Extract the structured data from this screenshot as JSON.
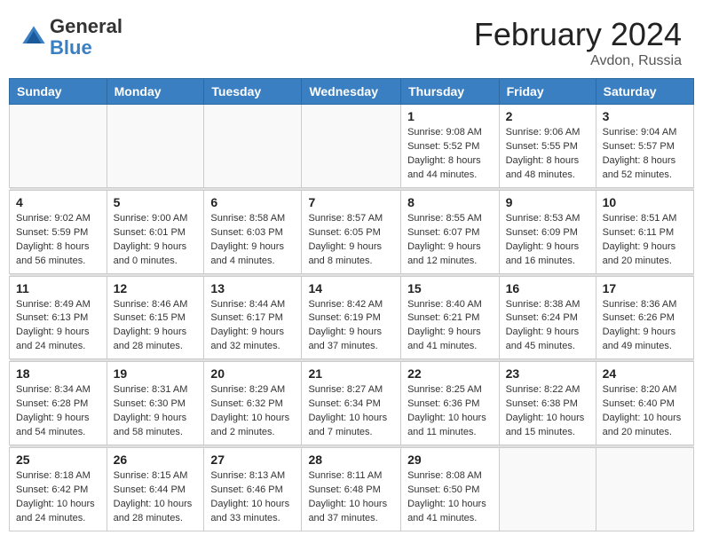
{
  "header": {
    "logo_general": "General",
    "logo_blue": "Blue",
    "month_year": "February 2024",
    "location": "Avdon, Russia"
  },
  "days_of_week": [
    "Sunday",
    "Monday",
    "Tuesday",
    "Wednesday",
    "Thursday",
    "Friday",
    "Saturday"
  ],
  "weeks": [
    [
      {
        "day": "",
        "info": "",
        "empty": true
      },
      {
        "day": "",
        "info": "",
        "empty": true
      },
      {
        "day": "",
        "info": "",
        "empty": true
      },
      {
        "day": "",
        "info": "",
        "empty": true
      },
      {
        "day": "1",
        "info": "Sunrise: 9:08 AM\nSunset: 5:52 PM\nDaylight: 8 hours\nand 44 minutes.",
        "empty": false
      },
      {
        "day": "2",
        "info": "Sunrise: 9:06 AM\nSunset: 5:55 PM\nDaylight: 8 hours\nand 48 minutes.",
        "empty": false
      },
      {
        "day": "3",
        "info": "Sunrise: 9:04 AM\nSunset: 5:57 PM\nDaylight: 8 hours\nand 52 minutes.",
        "empty": false
      }
    ],
    [
      {
        "day": "4",
        "info": "Sunrise: 9:02 AM\nSunset: 5:59 PM\nDaylight: 8 hours\nand 56 minutes.",
        "empty": false
      },
      {
        "day": "5",
        "info": "Sunrise: 9:00 AM\nSunset: 6:01 PM\nDaylight: 9 hours\nand 0 minutes.",
        "empty": false
      },
      {
        "day": "6",
        "info": "Sunrise: 8:58 AM\nSunset: 6:03 PM\nDaylight: 9 hours\nand 4 minutes.",
        "empty": false
      },
      {
        "day": "7",
        "info": "Sunrise: 8:57 AM\nSunset: 6:05 PM\nDaylight: 9 hours\nand 8 minutes.",
        "empty": false
      },
      {
        "day": "8",
        "info": "Sunrise: 8:55 AM\nSunset: 6:07 PM\nDaylight: 9 hours\nand 12 minutes.",
        "empty": false
      },
      {
        "day": "9",
        "info": "Sunrise: 8:53 AM\nSunset: 6:09 PM\nDaylight: 9 hours\nand 16 minutes.",
        "empty": false
      },
      {
        "day": "10",
        "info": "Sunrise: 8:51 AM\nSunset: 6:11 PM\nDaylight: 9 hours\nand 20 minutes.",
        "empty": false
      }
    ],
    [
      {
        "day": "11",
        "info": "Sunrise: 8:49 AM\nSunset: 6:13 PM\nDaylight: 9 hours\nand 24 minutes.",
        "empty": false
      },
      {
        "day": "12",
        "info": "Sunrise: 8:46 AM\nSunset: 6:15 PM\nDaylight: 9 hours\nand 28 minutes.",
        "empty": false
      },
      {
        "day": "13",
        "info": "Sunrise: 8:44 AM\nSunset: 6:17 PM\nDaylight: 9 hours\nand 32 minutes.",
        "empty": false
      },
      {
        "day": "14",
        "info": "Sunrise: 8:42 AM\nSunset: 6:19 PM\nDaylight: 9 hours\nand 37 minutes.",
        "empty": false
      },
      {
        "day": "15",
        "info": "Sunrise: 8:40 AM\nSunset: 6:21 PM\nDaylight: 9 hours\nand 41 minutes.",
        "empty": false
      },
      {
        "day": "16",
        "info": "Sunrise: 8:38 AM\nSunset: 6:24 PM\nDaylight: 9 hours\nand 45 minutes.",
        "empty": false
      },
      {
        "day": "17",
        "info": "Sunrise: 8:36 AM\nSunset: 6:26 PM\nDaylight: 9 hours\nand 49 minutes.",
        "empty": false
      }
    ],
    [
      {
        "day": "18",
        "info": "Sunrise: 8:34 AM\nSunset: 6:28 PM\nDaylight: 9 hours\nand 54 minutes.",
        "empty": false
      },
      {
        "day": "19",
        "info": "Sunrise: 8:31 AM\nSunset: 6:30 PM\nDaylight: 9 hours\nand 58 minutes.",
        "empty": false
      },
      {
        "day": "20",
        "info": "Sunrise: 8:29 AM\nSunset: 6:32 PM\nDaylight: 10 hours\nand 2 minutes.",
        "empty": false
      },
      {
        "day": "21",
        "info": "Sunrise: 8:27 AM\nSunset: 6:34 PM\nDaylight: 10 hours\nand 7 minutes.",
        "empty": false
      },
      {
        "day": "22",
        "info": "Sunrise: 8:25 AM\nSunset: 6:36 PM\nDaylight: 10 hours\nand 11 minutes.",
        "empty": false
      },
      {
        "day": "23",
        "info": "Sunrise: 8:22 AM\nSunset: 6:38 PM\nDaylight: 10 hours\nand 15 minutes.",
        "empty": false
      },
      {
        "day": "24",
        "info": "Sunrise: 8:20 AM\nSunset: 6:40 PM\nDaylight: 10 hours\nand 20 minutes.",
        "empty": false
      }
    ],
    [
      {
        "day": "25",
        "info": "Sunrise: 8:18 AM\nSunset: 6:42 PM\nDaylight: 10 hours\nand 24 minutes.",
        "empty": false
      },
      {
        "day": "26",
        "info": "Sunrise: 8:15 AM\nSunset: 6:44 PM\nDaylight: 10 hours\nand 28 minutes.",
        "empty": false
      },
      {
        "day": "27",
        "info": "Sunrise: 8:13 AM\nSunset: 6:46 PM\nDaylight: 10 hours\nand 33 minutes.",
        "empty": false
      },
      {
        "day": "28",
        "info": "Sunrise: 8:11 AM\nSunset: 6:48 PM\nDaylight: 10 hours\nand 37 minutes.",
        "empty": false
      },
      {
        "day": "29",
        "info": "Sunrise: 8:08 AM\nSunset: 6:50 PM\nDaylight: 10 hours\nand 41 minutes.",
        "empty": false
      },
      {
        "day": "",
        "info": "",
        "empty": true
      },
      {
        "day": "",
        "info": "",
        "empty": true
      }
    ]
  ]
}
